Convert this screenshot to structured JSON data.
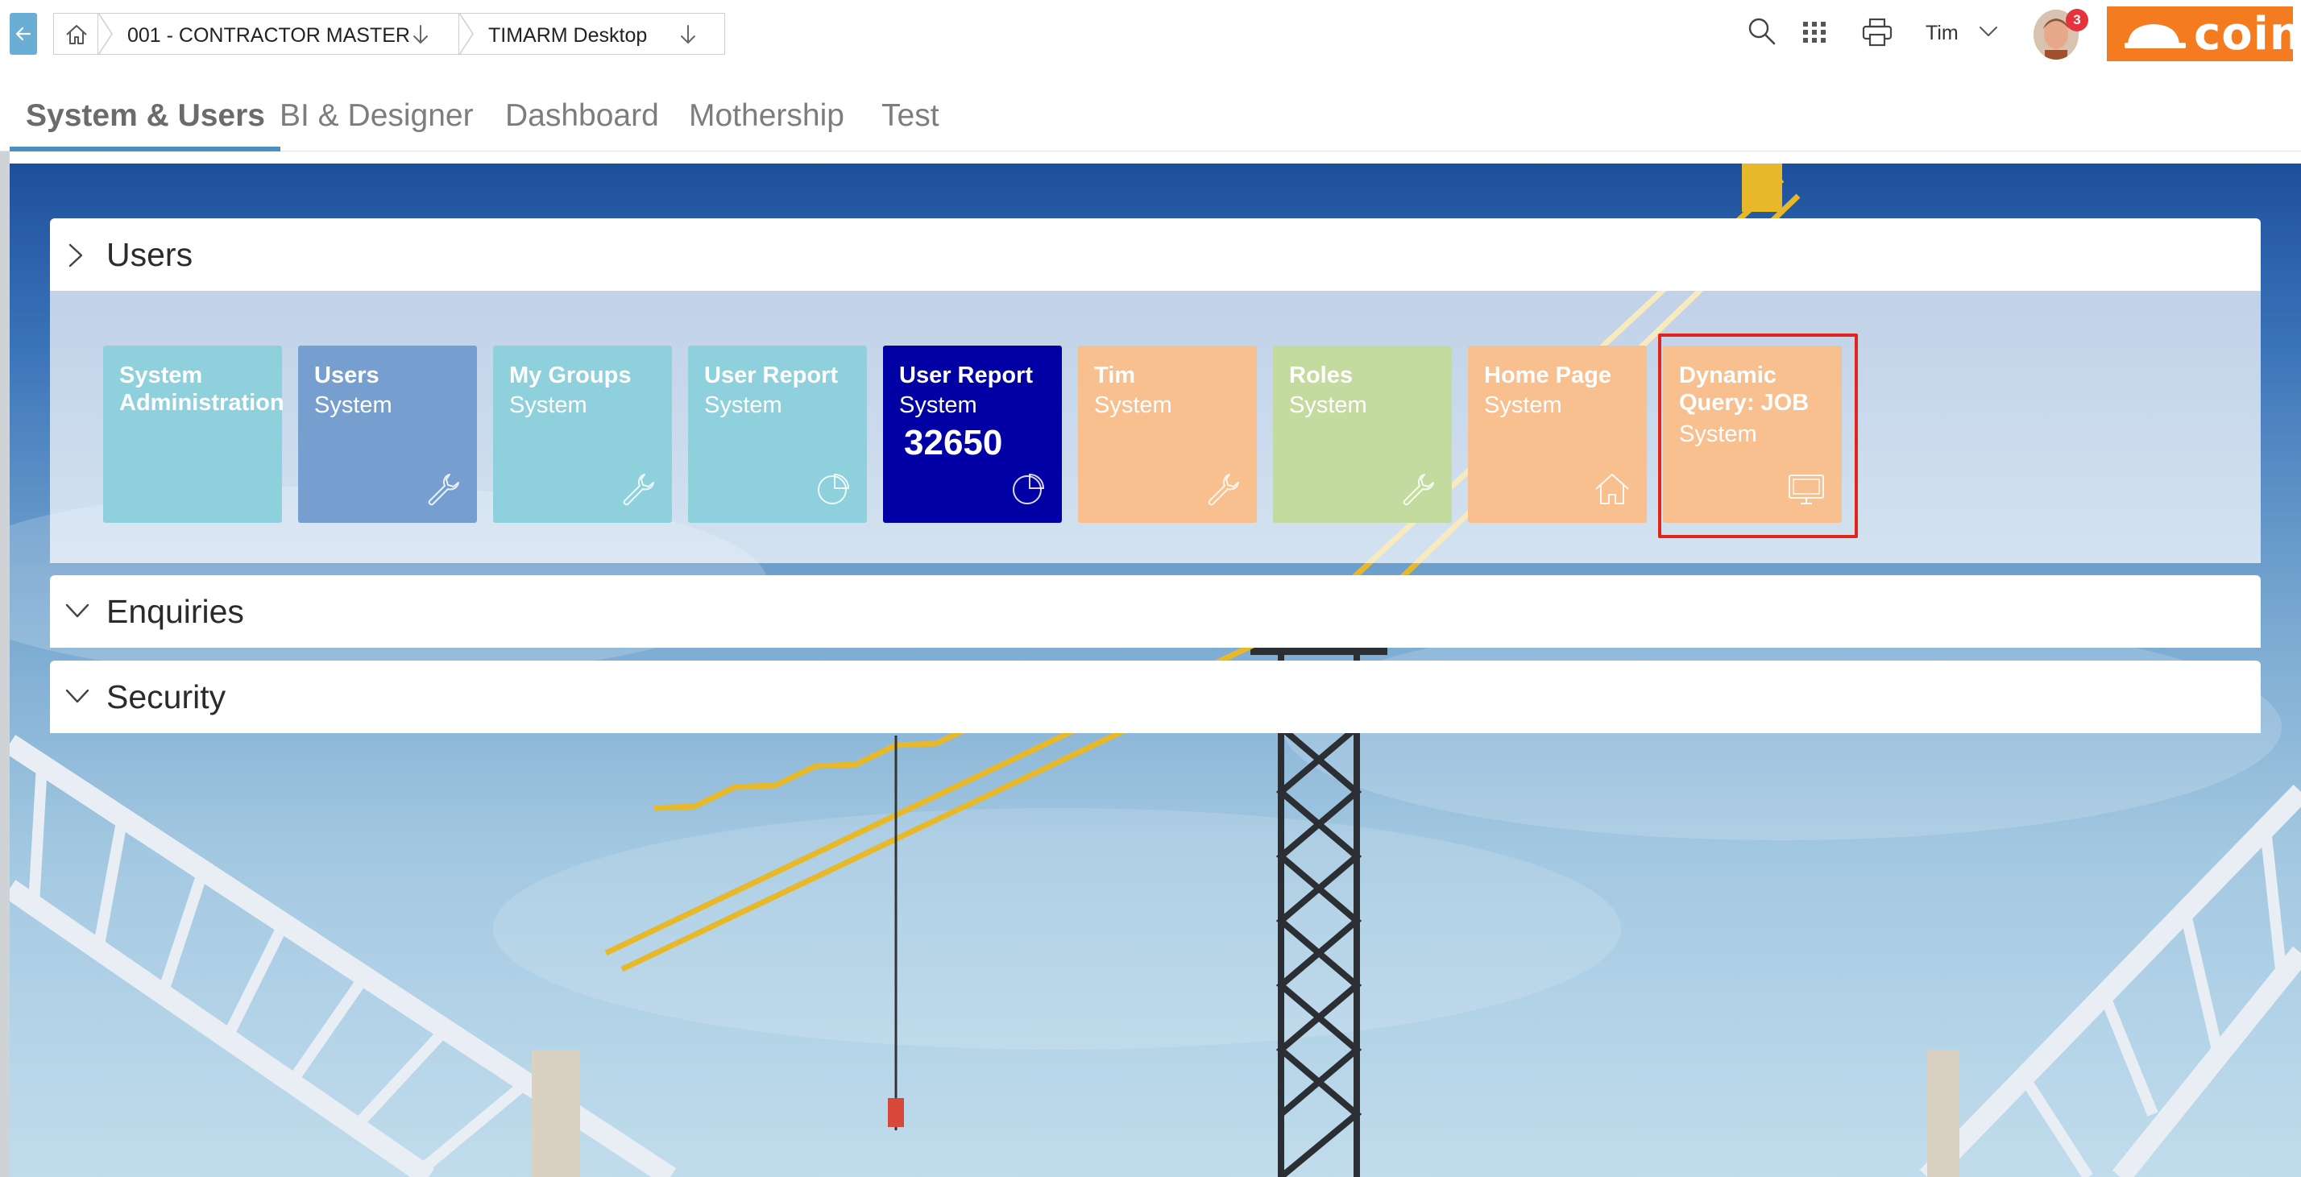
{
  "header": {
    "breadcrumb": [
      {
        "label": "001 - CONTRACTOR MASTER"
      },
      {
        "label": "TIMARM Desktop"
      }
    ],
    "user_name": "Tim",
    "notification_count": "3",
    "logo_text": "coins"
  },
  "tabs": [
    {
      "label": "System & Users",
      "active": true
    },
    {
      "label": "BI & Designer",
      "active": false
    },
    {
      "label": "Dashboard",
      "active": false
    },
    {
      "label": "Mothership",
      "active": false
    },
    {
      "label": "Test",
      "active": false
    }
  ],
  "panels": [
    {
      "title": "Users",
      "expanded": true
    },
    {
      "title": "Enquiries",
      "expanded": false
    },
    {
      "title": "Security",
      "expanded": false
    }
  ],
  "tiles": [
    {
      "title": "System Administration",
      "subtitle": "",
      "count": "",
      "icon": "none",
      "color": "#8fd0dd"
    },
    {
      "title": "Users",
      "subtitle": "System",
      "count": "",
      "icon": "wrench-icon",
      "color": "#769fd0"
    },
    {
      "title": "My Groups",
      "subtitle": "System",
      "count": "",
      "icon": "wrench-icon",
      "color": "#8fd0dd"
    },
    {
      "title": "User Report",
      "subtitle": "System",
      "count": "",
      "icon": "pie-chart-icon",
      "color": "#8fd0dd"
    },
    {
      "title": "User Report",
      "subtitle": "System",
      "count": "32650",
      "icon": "pie-chart-icon",
      "color": "#0000a4"
    },
    {
      "title": "Tim",
      "subtitle": "System",
      "count": "",
      "icon": "wrench-icon",
      "color": "#f8bf8f"
    },
    {
      "title": "Roles",
      "subtitle": "System",
      "count": "",
      "icon": "wrench-icon",
      "color": "#c4dba0"
    },
    {
      "title": "Home Page",
      "subtitle": "System",
      "count": "",
      "icon": "home-icon",
      "color": "#f8bf8f"
    },
    {
      "title": "Dynamic Query: JOB",
      "subtitle": "System",
      "count": "",
      "icon": "monitor-icon",
      "color": "#f8bf8f"
    }
  ],
  "colors": {
    "accent": "#4a90c2",
    "logo": "#f47b20",
    "highlight": "#e0251b"
  }
}
